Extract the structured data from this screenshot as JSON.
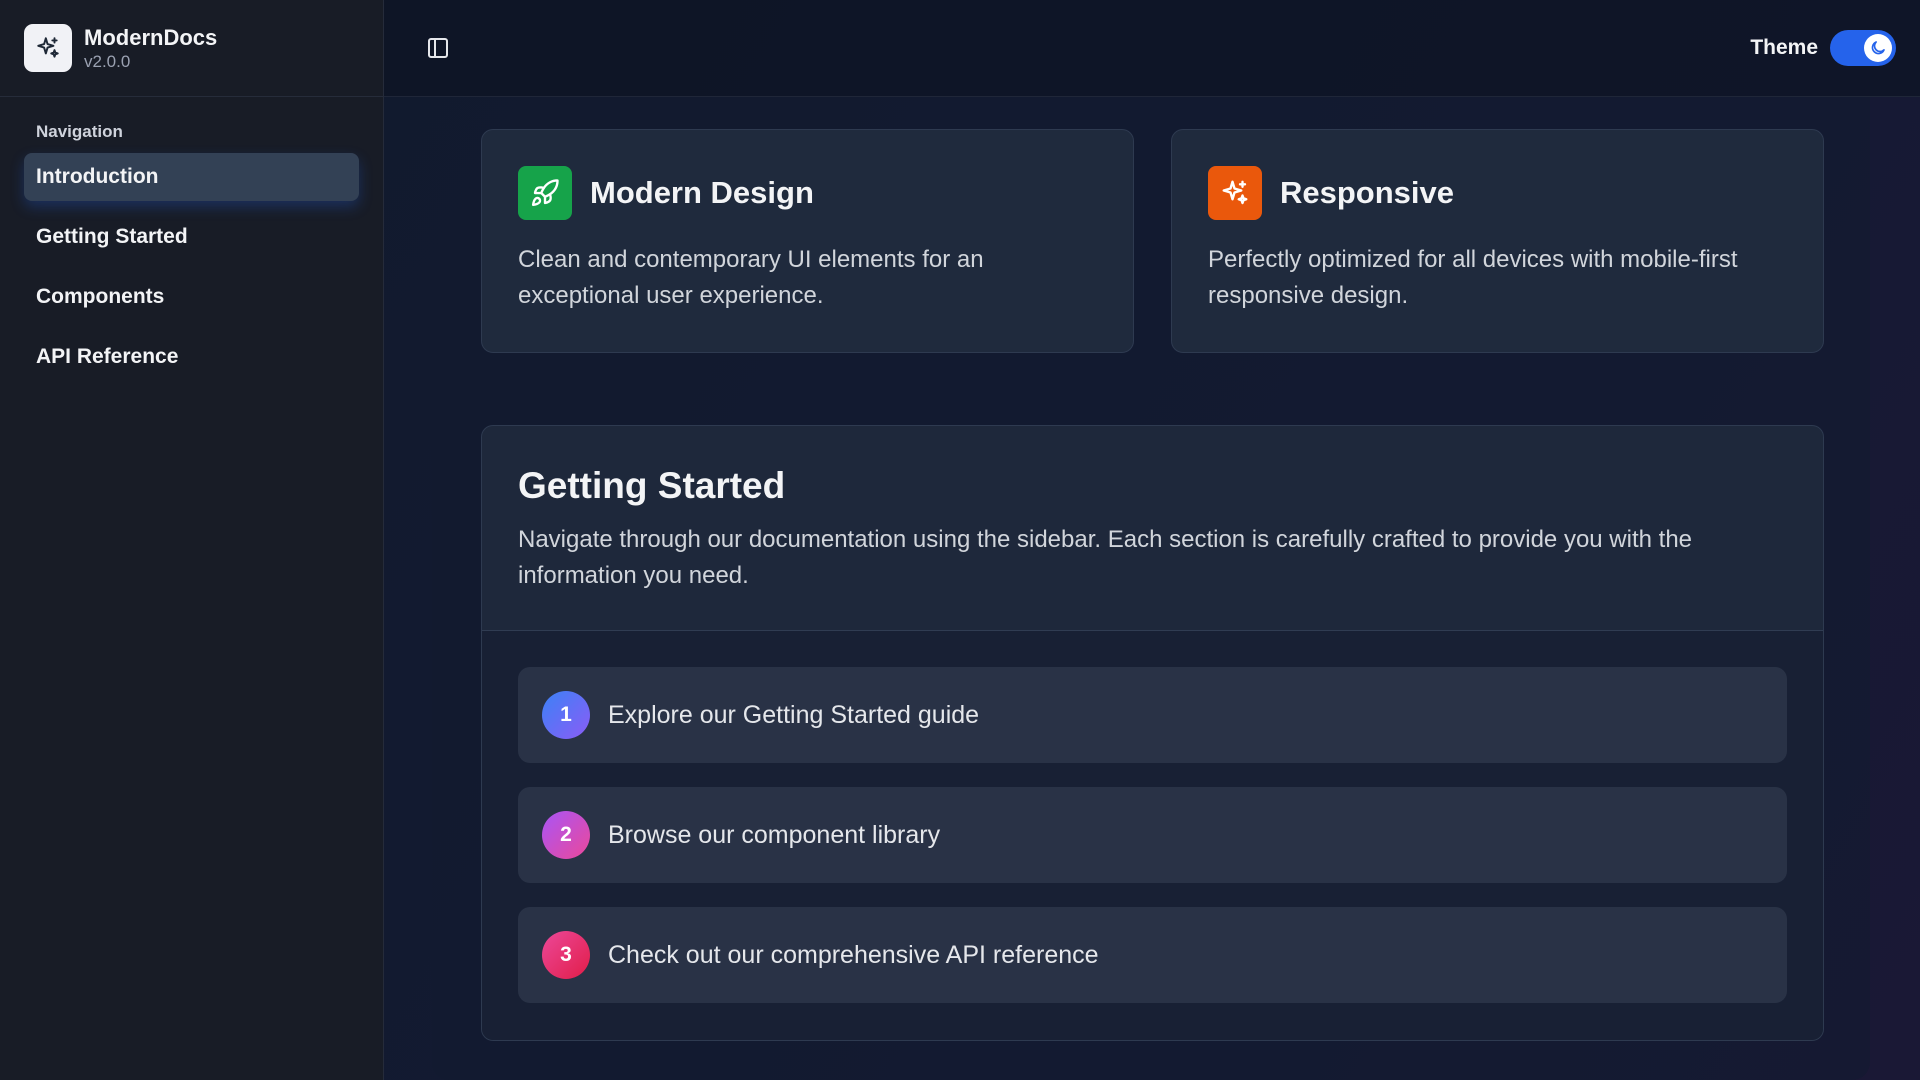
{
  "brand": {
    "name": "ModernDocs",
    "version": "v2.0.0",
    "logo_icon": "sparkles-icon"
  },
  "sidebar": {
    "heading": "Navigation",
    "items": [
      {
        "label": "Introduction",
        "active": true
      },
      {
        "label": "Getting Started",
        "active": false
      },
      {
        "label": "Components",
        "active": false
      },
      {
        "label": "API Reference",
        "active": false
      }
    ]
  },
  "topbar": {
    "toggle_sidebar_icon": "sidebar-panel-icon",
    "theme_label": "Theme",
    "theme_mode_icon": "moon-icon"
  },
  "features": [
    {
      "title": "Modern Design",
      "description": "Clean and contemporary UI elements for an exceptional user experience.",
      "icon": "rocket-icon",
      "color": "#16a34a"
    },
    {
      "title": "Responsive",
      "description": "Perfectly optimized for all devices with mobile-first responsive design.",
      "icon": "sparkles-icon",
      "color": "#ea580c"
    }
  ],
  "getting_started": {
    "title": "Getting Started",
    "description": "Navigate through our documentation using the sidebar. Each section is carefully crafted to provide you with the information you need.",
    "steps": [
      {
        "number": "1",
        "text": "Explore our Getting Started guide"
      },
      {
        "number": "2",
        "text": "Browse our component library"
      },
      {
        "number": "3",
        "text": "Check out our comprehensive API reference"
      }
    ]
  },
  "colors": {
    "accent": "#2563eb",
    "step1": [
      "#3b82f6",
      "#8b5cf6"
    ],
    "step2": [
      "#a855f7",
      "#ec4899"
    ],
    "step3": [
      "#ec4899",
      "#e11d48"
    ]
  }
}
